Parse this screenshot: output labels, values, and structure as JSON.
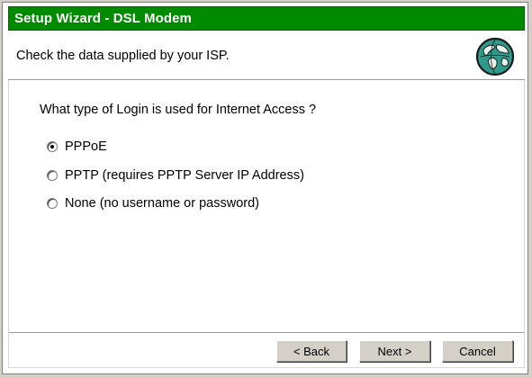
{
  "window": {
    "title": "Setup Wizard - DSL Modem"
  },
  "header": {
    "text": "Check the data supplied by your ISP.",
    "icon": "globe-icon"
  },
  "main": {
    "question": "What type of Login is used for Internet Access ?",
    "options": [
      {
        "label": "PPPoE",
        "checked": true
      },
      {
        "label": "PPTP (requires PPTP Server IP Address)",
        "checked": false
      },
      {
        "label": "None (no username or password)",
        "checked": false
      }
    ]
  },
  "footer": {
    "back_label": "< Back",
    "next_label": "Next >",
    "cancel_label": "Cancel"
  },
  "colors": {
    "title_bar": "#008a00",
    "title_text": "#ffffff",
    "background": "#d4d0c8"
  }
}
